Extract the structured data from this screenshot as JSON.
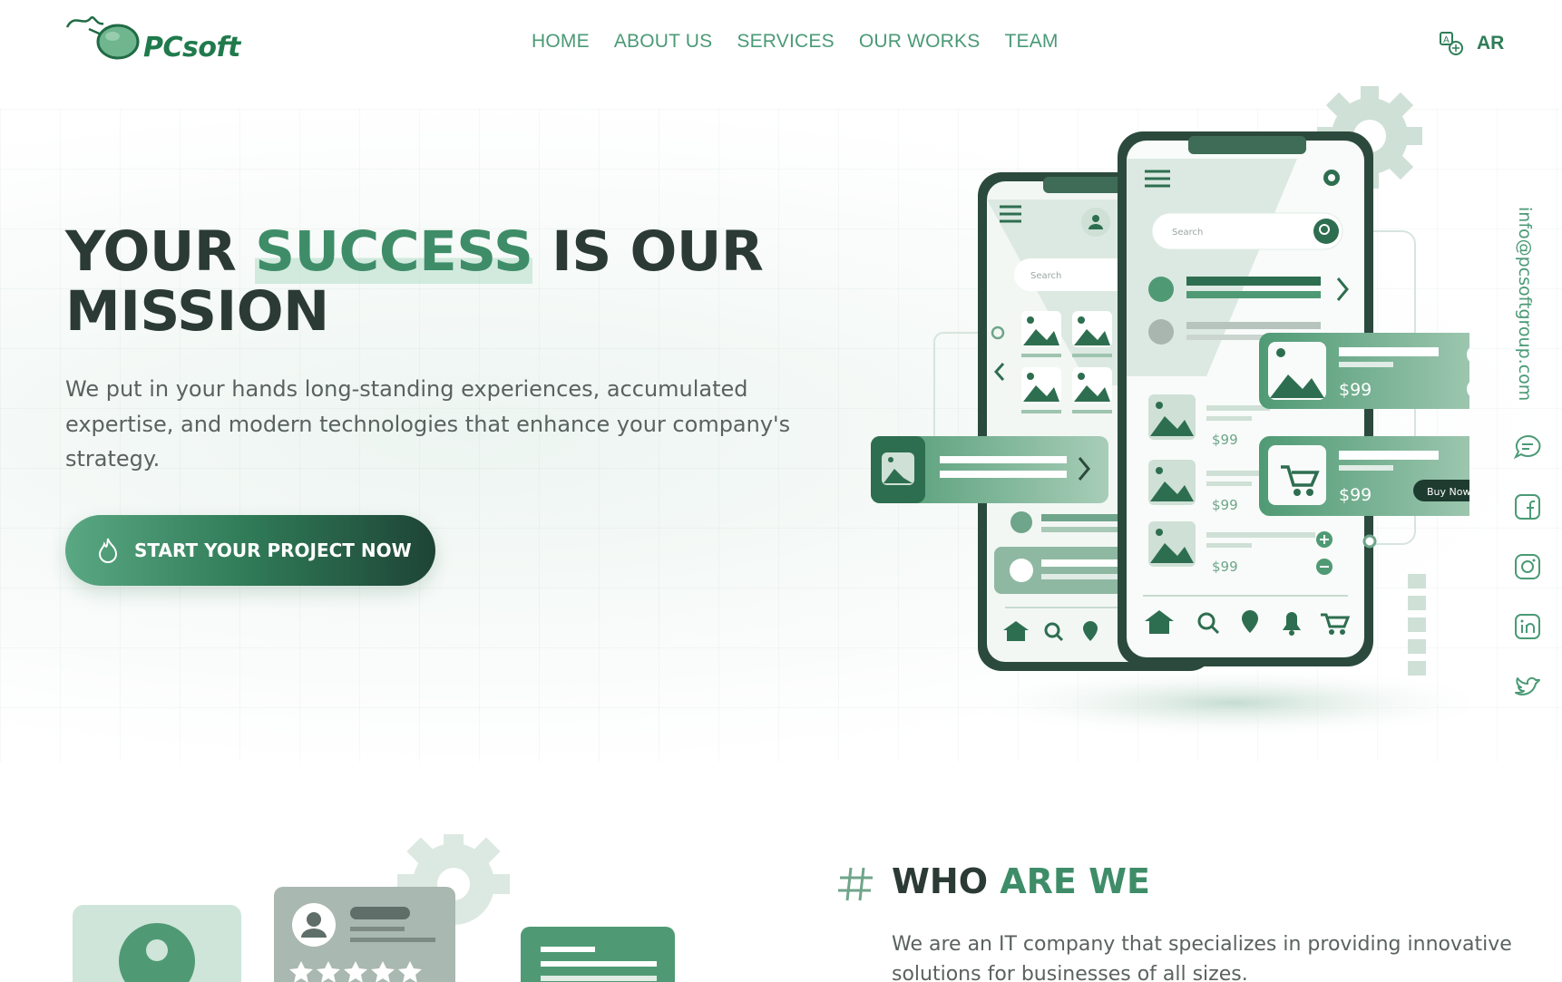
{
  "brand": {
    "name": "PCsoft"
  },
  "nav": {
    "items": [
      {
        "label": "HOME"
      },
      {
        "label": "ABOUT US"
      },
      {
        "label": "SERVICES"
      },
      {
        "label": "OUR WORKS"
      },
      {
        "label": "TEAM"
      }
    ]
  },
  "language": {
    "label": "AR",
    "icon": "translate-icon"
  },
  "hero": {
    "title_part1": "YOUR ",
    "title_highlight": "SUCCESS",
    "title_part2": " IS OUR MISSION",
    "description": "We put in your hands long-standing experiences, accumulated expertise, and modern technologies that enhance your company's strategy.",
    "cta_label": "START YOUR PROJECT NOW",
    "cta_icon": "flame-icon"
  },
  "illustration": {
    "search_placeholder": "Search",
    "price": "$99",
    "buy_now": "Buy Now"
  },
  "contact": {
    "email": "info@pcsoftgroup.com"
  },
  "social": [
    {
      "name": "chat-icon"
    },
    {
      "name": "facebook-icon"
    },
    {
      "name": "instagram-icon"
    },
    {
      "name": "linkedin-icon"
    },
    {
      "name": "twitter-icon"
    }
  ],
  "who": {
    "title_part1": "WHO ",
    "title_accent": "ARE WE",
    "description": "We are an IT company that specializes in providing innovative solutions for businesses of all sizes."
  },
  "colors": {
    "primary": "#3e8d68",
    "dark": "#2b3a35",
    "light": "#cfe5d9"
  }
}
